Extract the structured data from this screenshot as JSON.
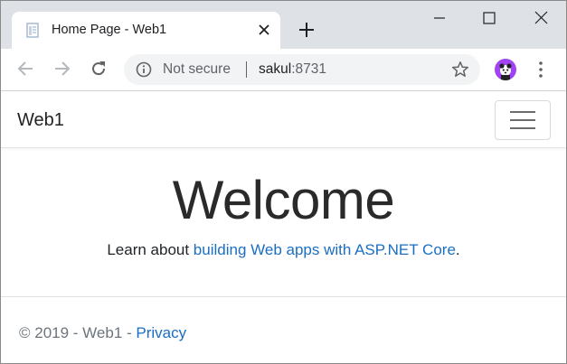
{
  "browser": {
    "tab": {
      "title": "Home Page - Web1",
      "favicon": "page-icon",
      "close_icon": "close-icon"
    },
    "new_tab_icon": "plus-icon",
    "window_controls": [
      "minimize-icon",
      "maximize-icon",
      "close-icon"
    ],
    "toolbar": {
      "back_icon": "arrow-left-icon",
      "forward_icon": "arrow-right-icon",
      "reload_icon": "reload-icon",
      "security_label": "Not secure",
      "url_host": "sakul",
      "url_port": ":8731",
      "bookmark_icon": "star-icon",
      "menu_icon": "kebab-menu-icon"
    }
  },
  "page": {
    "navbar": {
      "brand": "Web1",
      "toggler_icon": "hamburger-icon"
    },
    "main": {
      "heading": "Welcome",
      "lead_prefix": "Learn about ",
      "lead_link": "building Web apps with ASP.NET Core",
      "lead_suffix": "."
    },
    "footer": {
      "copyright": "© 2019 - Web1 - ",
      "privacy_link": "Privacy"
    }
  },
  "colors": {
    "tabstrip": "#dee1e6",
    "omnibox": "#f1f3f4",
    "link": "#1b6ec2",
    "avatar": "#a142f4"
  }
}
